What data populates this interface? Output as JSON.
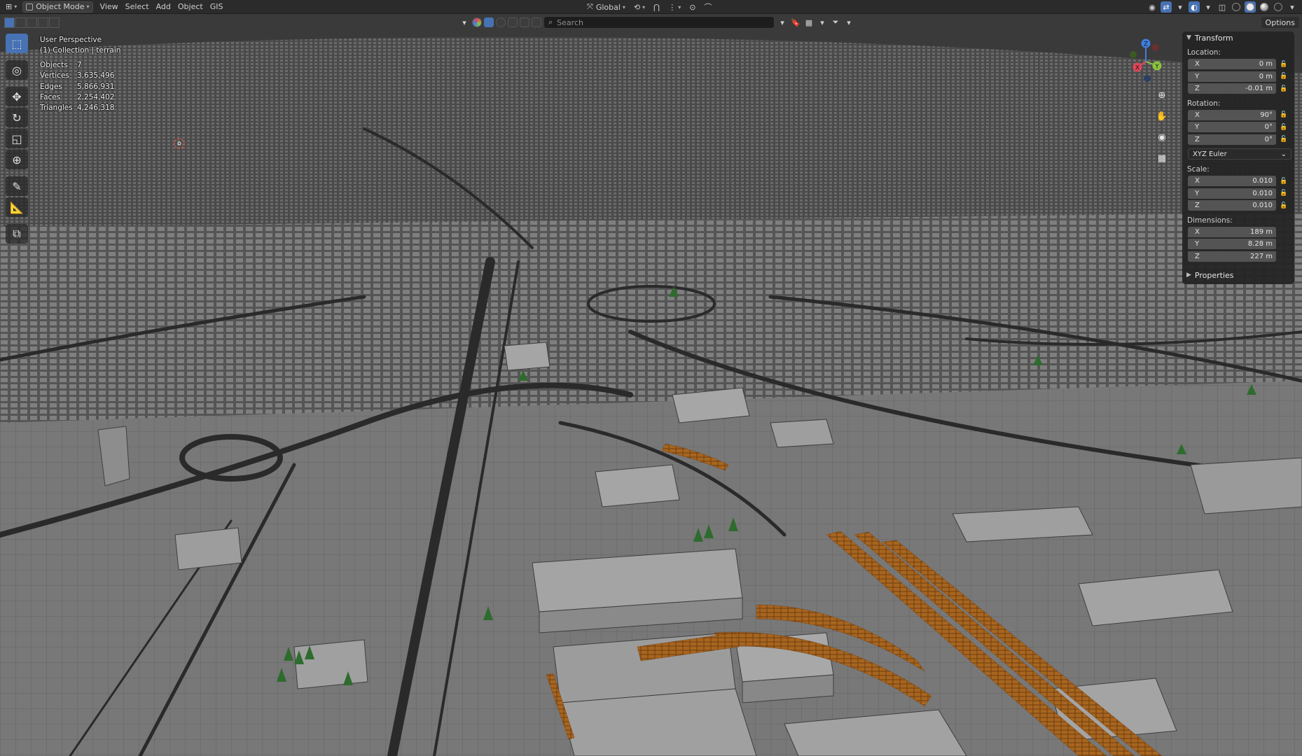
{
  "colors": {
    "header_bg": "#2b2b2b",
    "accent": "#4772b3",
    "ground": "#787878",
    "building_top": "#a4a4a4",
    "building_side": "#8a8a8a",
    "roads": "#2a2a2a",
    "railway": "#b8762a",
    "trees": "#2e6b2e",
    "axis_x": "#e0455a",
    "axis_y": "#8bc43f",
    "axis_z": "#3f7fe0"
  },
  "header": {
    "editor_icon": "3d-viewport-icon",
    "mode": "Object Mode",
    "menus": [
      "View",
      "Select",
      "Add",
      "Object",
      "GIS"
    ],
    "transform_orientation": "Global"
  },
  "viewport_toolbar": {
    "search_placeholder": "Search"
  },
  "options_label": "Options",
  "overlay": {
    "perspective": "User Perspective",
    "collection": "(1) Collection | terrain",
    "stats": [
      {
        "label": "Objects",
        "value": "7"
      },
      {
        "label": "Vertices",
        "value": "3,635,496"
      },
      {
        "label": "Edges",
        "value": "5,866,931"
      },
      {
        "label": "Faces",
        "value": "2,254,402"
      },
      {
        "label": "Triangles",
        "value": "4,246,318"
      }
    ]
  },
  "tools": [
    {
      "name": "select-box-tool",
      "icon": "select-box-icon",
      "glyph": "⬚"
    },
    {
      "name": "cursor-tool",
      "icon": "cursor-icon",
      "glyph": "◎"
    },
    {
      "name": "move-tool",
      "icon": "move-icon",
      "glyph": "✥"
    },
    {
      "name": "rotate-tool",
      "icon": "rotate-icon",
      "glyph": "↻"
    },
    {
      "name": "scale-tool",
      "icon": "scale-icon",
      "glyph": "◱"
    },
    {
      "name": "transform-tool",
      "icon": "transform-icon",
      "glyph": "⊕"
    },
    {
      "name": "annotate-tool",
      "icon": "annotate-icon",
      "glyph": "✎"
    },
    {
      "name": "measure-tool",
      "icon": "measure-icon",
      "glyph": "📐"
    },
    {
      "name": "add-cube-tool",
      "icon": "add-cube-icon",
      "glyph": "⧉"
    }
  ],
  "gizmo": {
    "x": "X",
    "y": "Y",
    "z": "Z"
  },
  "transform_panel": {
    "title": "Transform",
    "location_label": "Location:",
    "location": [
      {
        "axis": "X",
        "value": "0 m"
      },
      {
        "axis": "Y",
        "value": "0 m"
      },
      {
        "axis": "Z",
        "value": "-0.01 m"
      }
    ],
    "rotation_label": "Rotation:",
    "rotation": [
      {
        "axis": "X",
        "value": "90°"
      },
      {
        "axis": "Y",
        "value": "0°"
      },
      {
        "axis": "Z",
        "value": "0°"
      }
    ],
    "rotation_mode": "XYZ Euler",
    "scale_label": "Scale:",
    "scale": [
      {
        "axis": "X",
        "value": "0.010"
      },
      {
        "axis": "Y",
        "value": "0.010"
      },
      {
        "axis": "Z",
        "value": "0.010"
      }
    ],
    "dimensions_label": "Dimensions:",
    "dimensions": [
      {
        "axis": "X",
        "value": "189 m"
      },
      {
        "axis": "Y",
        "value": "8.28 m"
      },
      {
        "axis": "Z",
        "value": "227 m"
      }
    ],
    "properties_label": "Properties"
  }
}
